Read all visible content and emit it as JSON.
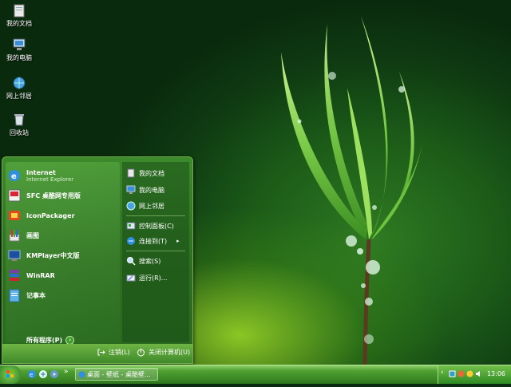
{
  "desktop": {
    "icons": [
      {
        "label": "我的文档",
        "icon": "folder-documents-icon"
      },
      {
        "label": "我的电脑",
        "icon": "computer-icon"
      },
      {
        "label": "网上邻居",
        "icon": "network-icon"
      },
      {
        "label": "回收站",
        "icon": "recycle-bin-icon"
      }
    ]
  },
  "start_menu": {
    "pinned": [
      {
        "label": "Internet",
        "sublabel": "Internet Explorer",
        "icon": "internet-explorer-icon"
      },
      {
        "label": "SFC 桌酷网专用版",
        "icon": "sfc-icon"
      },
      {
        "label": "IconPackager",
        "icon": "iconpackager-icon"
      },
      {
        "label": "画图",
        "icon": "paint-icon"
      },
      {
        "label": "KMPlayer中文版",
        "icon": "kmplayer-icon"
      },
      {
        "label": "WinRAR",
        "icon": "winrar-icon"
      },
      {
        "label": "记事本",
        "icon": "notepad-icon"
      }
    ],
    "all_programs": "所有程序(P)",
    "right": [
      {
        "label": "我的文档",
        "icon": "documents-icon"
      },
      {
        "label": "我的电脑",
        "icon": "computer-icon"
      },
      {
        "label": "网上邻居",
        "icon": "network-icon"
      },
      {
        "label": "控制面板(C)",
        "icon": "control-panel-icon"
      },
      {
        "label": "连接到(T)",
        "icon": "connect-icon"
      },
      {
        "label": "搜索(S)",
        "icon": "search-icon"
      },
      {
        "label": "运行(R)...",
        "icon": "run-icon"
      }
    ],
    "logoff": "注销(L)",
    "shutdown": "关闭计算机(U)"
  },
  "taskbar": {
    "task_label": "桌面 - 壁纸 - 桌酷壁...",
    "clock": "13:06",
    "quick_launch_more": "»",
    "tray_expand": "‹"
  },
  "colors": {
    "accent": "#3d8a26",
    "menu_bg": "#2e6f22"
  }
}
